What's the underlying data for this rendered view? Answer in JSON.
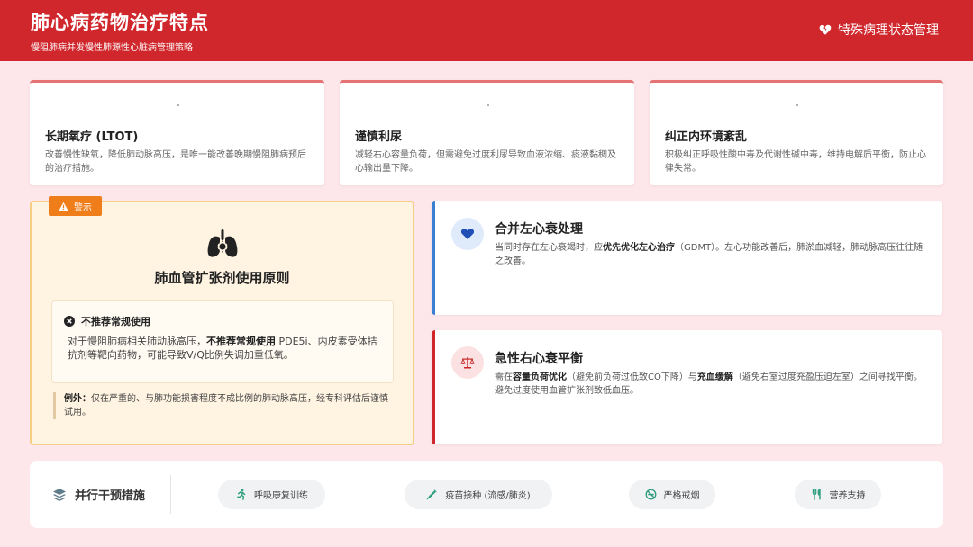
{
  "header": {
    "title": "肺心病药物治疗特点",
    "subtitle": "慢阻肺病并发慢性肺源性心脏病管理策略",
    "right_label": "特殊病理状态管理",
    "right_icon": "heart-crack-icon"
  },
  "top_cards": [
    {
      "title": "长期氧疗 (LTOT)",
      "desc": "改善慢性缺氧，降低肺动脉高压，是唯一能改善晚期慢阻肺病预后的治疗措施。"
    },
    {
      "title": "谨慎利尿",
      "desc": "减轻右心容量负荷，但需避免过度利尿导致血液浓缩、痰液黏稠及心输出量下降。"
    },
    {
      "title": "纠正内环境紊乱",
      "desc": "积极纠正呼吸性酸中毒及代谢性碱中毒，维持电解质平衡，防止心律失常。"
    }
  ],
  "warning": {
    "tag": "警示",
    "icon": "lungs-virus-icon",
    "title": "肺血管扩张剂使用原则",
    "inner_title": "不推荐常规使用",
    "inner_prefix": "对于慢阻肺病相关肺动脉高压，",
    "inner_bold": "不推荐常规使用",
    "inner_suffix": " PDE5i、内皮素受体拮抗剂等靶向药物，可能导致V/Q比例失调加重低氧。",
    "exception_label": "例外：",
    "exception_text": "仅在严重的、与肺功能损害程度不成比例的肺动脉高压，经专科评估后谨慎试用。"
  },
  "right_cards": [
    {
      "title": "合并左心衰处理",
      "icon": "heart-icon",
      "p1": "当同时存在左心衰竭时，应",
      "b1": "优先优化左心治疗",
      "p2": "（GDMT）。左心功能改善后，肺淤血减轻，肺动脉高压往往随之改善。",
      "b2": "",
      "p3": "",
      "accent": "#3b7fd4"
    },
    {
      "title": "急性右心衰平衡",
      "icon": "balance-scale-icon",
      "p1": "需在",
      "b1": "容量负荷优化",
      "p2": "（避免前负荷过低致CO下降）与",
      "b2": "充血缓解",
      "p3": "（避免右室过度充盈压迫左室）之间寻找平衡。避免过度使用血管扩张剂致低血压。",
      "accent": "#d0272d"
    }
  ],
  "bottom": {
    "label": "并行干预措施",
    "icon": "layers-icon",
    "items": [
      {
        "label": "呼吸康复训练",
        "icon": "running-icon"
      },
      {
        "label": "疫苗接种 (流感/肺炎)",
        "icon": "syringe-icon"
      },
      {
        "label": "严格戒烟",
        "icon": "no-smoking-icon"
      },
      {
        "label": "营养支持",
        "icon": "utensils-icon"
      }
    ]
  },
  "colors": {
    "primary_red": "#d0272d",
    "warning_orange": "#ef7d1a",
    "info_blue": "#3b7fd4",
    "accent_green": "#2e9e7e",
    "background": "#fde7ea"
  }
}
